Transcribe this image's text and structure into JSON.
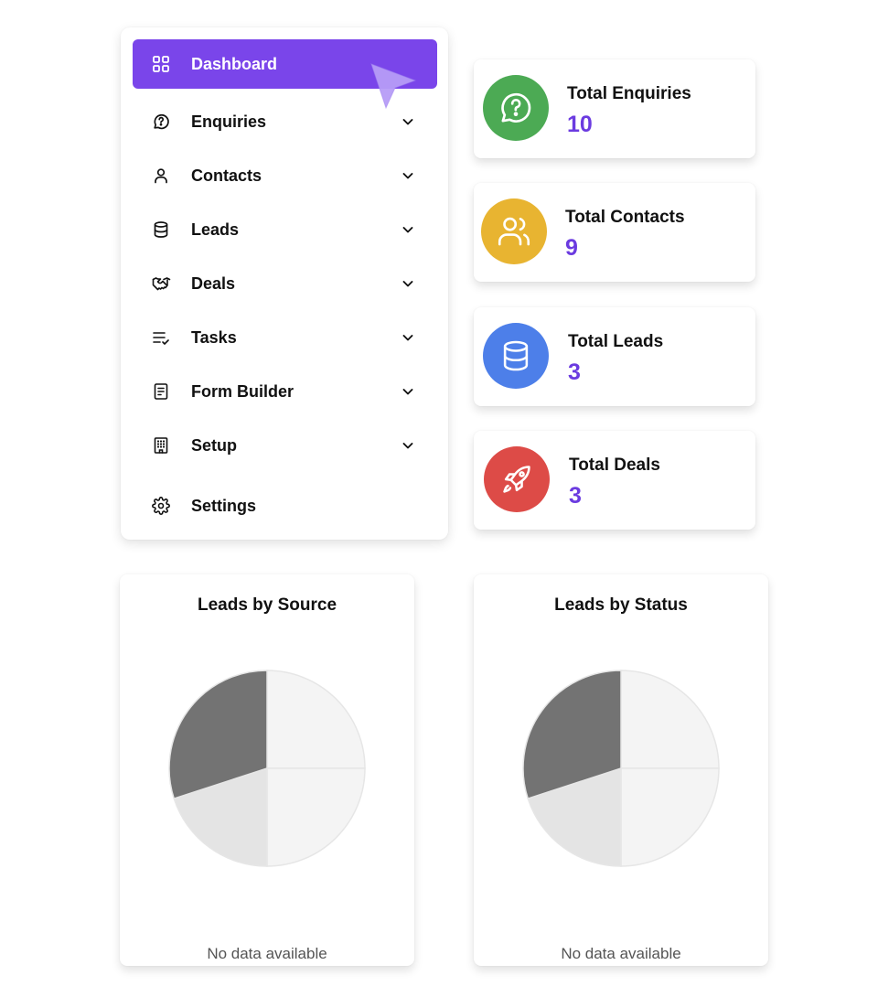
{
  "sidebar": {
    "items": [
      {
        "label": "Dashboard",
        "icon": "grid-icon",
        "active": true,
        "has_chevron": false
      },
      {
        "label": "Enquiries",
        "icon": "chat-question-icon",
        "has_chevron": true
      },
      {
        "label": "Contacts",
        "icon": "user-icon",
        "has_chevron": true
      },
      {
        "label": "Leads",
        "icon": "database-icon",
        "has_chevron": true
      },
      {
        "label": "Deals",
        "icon": "handshake-icon",
        "has_chevron": true
      },
      {
        "label": "Tasks",
        "icon": "task-list-icon",
        "has_chevron": true
      },
      {
        "label": "Form Builder",
        "icon": "form-icon",
        "has_chevron": true
      },
      {
        "label": "Setup",
        "icon": "building-icon",
        "has_chevron": true
      },
      {
        "label": "Settings",
        "icon": "gear-icon",
        "has_chevron": false
      }
    ],
    "accent_color": "#7a45ea"
  },
  "stats": [
    {
      "title": "Total Enquiries",
      "value": "10",
      "color": "#4caa54",
      "icon": "chat-question-icon"
    },
    {
      "title": "Total Contacts",
      "value": "9",
      "color": "#e8b431",
      "icon": "users-icon"
    },
    {
      "title": "Total Leads",
      "value": "3",
      "color": "#4d7fe9",
      "icon": "database-icon"
    },
    {
      "title": "Total Deals",
      "value": "3",
      "color": "#dd4b47",
      "icon": "rocket-icon"
    }
  ],
  "value_color": "#6b3be0",
  "charts": [
    {
      "title": "Leads by Source",
      "empty_text": "No data available"
    },
    {
      "title": "Leads by Status",
      "empty_text": "No data available"
    }
  ],
  "chart_data": [
    {
      "type": "pie",
      "title": "Leads by Source",
      "values": [
        25,
        25,
        20,
        30
      ],
      "colors": [
        "#f4f4f4",
        "#f4f4f4",
        "#e4e4e4",
        "#737373"
      ]
    },
    {
      "type": "pie",
      "title": "Leads by Status",
      "values": [
        25,
        25,
        20,
        30
      ],
      "colors": [
        "#f4f4f4",
        "#f4f4f4",
        "#e4e4e4",
        "#737373"
      ]
    }
  ]
}
